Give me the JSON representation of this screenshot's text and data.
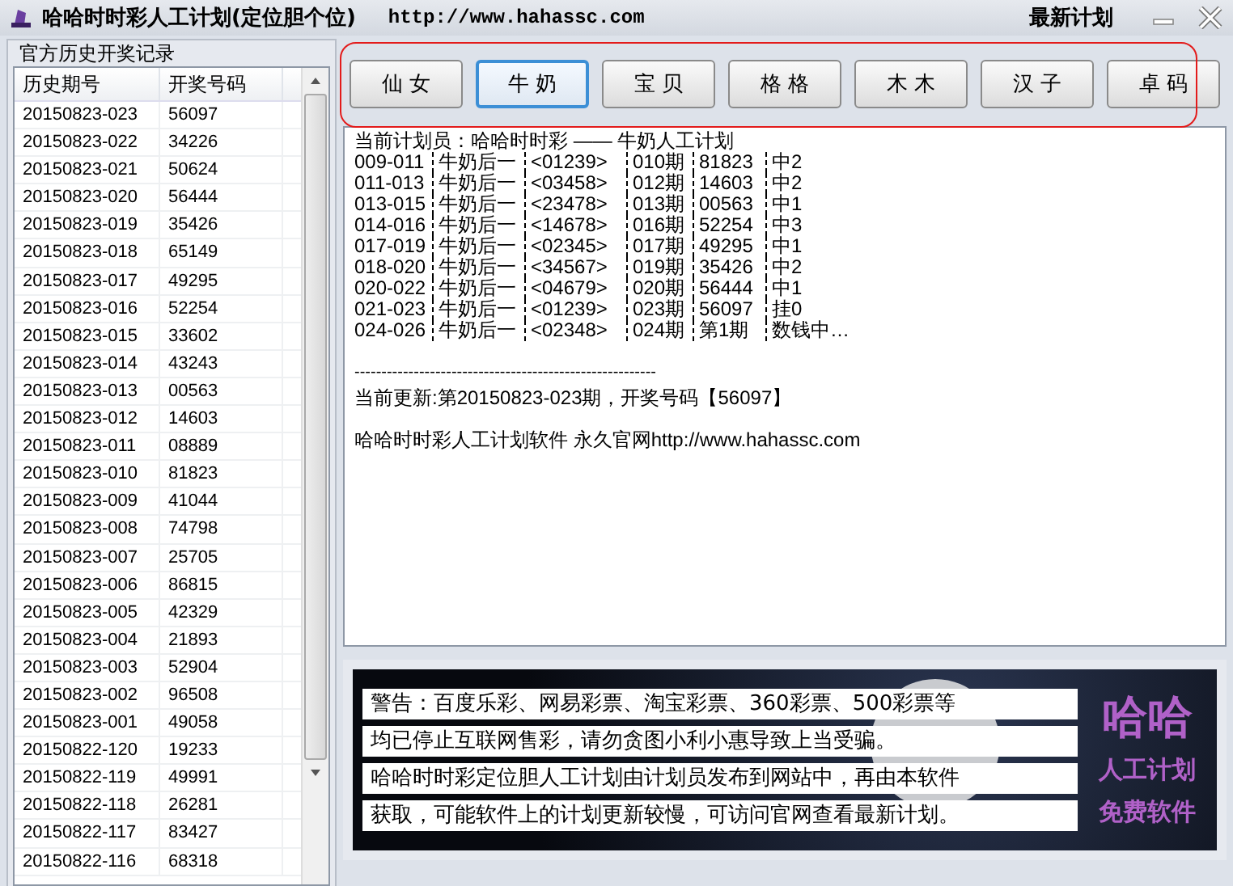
{
  "window": {
    "title": "哈哈时时彩人工计划(定位胆个位)",
    "url": "http://www.hahassc.com",
    "menu": "最新计划"
  },
  "history": {
    "title": "官方历史开奖记录",
    "columns": [
      "历史期号",
      "开奖号码"
    ],
    "rows": [
      [
        "20150823-023",
        "56097"
      ],
      [
        "20150823-022",
        "34226"
      ],
      [
        "20150823-021",
        "50624"
      ],
      [
        "20150823-020",
        "56444"
      ],
      [
        "20150823-019",
        "35426"
      ],
      [
        "20150823-018",
        "65149"
      ],
      [
        "20150823-017",
        "49295"
      ],
      [
        "20150823-016",
        "52254"
      ],
      [
        "20150823-015",
        "33602"
      ],
      [
        "20150823-014",
        "43243"
      ],
      [
        "20150823-013",
        "00563"
      ],
      [
        "20150823-012",
        "14603"
      ],
      [
        "20150823-011",
        "08889"
      ],
      [
        "20150823-010",
        "81823"
      ],
      [
        "20150823-009",
        "41044"
      ],
      [
        "20150823-008",
        "74798"
      ],
      [
        "20150823-007",
        "25705"
      ],
      [
        "20150823-006",
        "86815"
      ],
      [
        "20150823-005",
        "42329"
      ],
      [
        "20150823-004",
        "21893"
      ],
      [
        "20150823-003",
        "52904"
      ],
      [
        "20150823-002",
        "96508"
      ],
      [
        "20150823-001",
        "49058"
      ],
      [
        "20150822-120",
        "19233"
      ],
      [
        "20150822-119",
        "49991"
      ],
      [
        "20150822-118",
        "26281"
      ],
      [
        "20150822-117",
        "83427"
      ],
      [
        "20150822-116",
        "68318"
      ]
    ]
  },
  "planners": [
    {
      "label": "仙 女",
      "selected": false
    },
    {
      "label": "牛 奶",
      "selected": true
    },
    {
      "label": "宝 贝",
      "selected": false
    },
    {
      "label": "格 格",
      "selected": false
    },
    {
      "label": "木 木",
      "selected": false
    },
    {
      "label": "汉 子",
      "selected": false
    },
    {
      "label": "卓 码",
      "selected": false
    }
  ],
  "plan": {
    "heading": "当前计划员：哈哈时时彩 —— 牛奶人工计划",
    "lines": [
      [
        "009-011",
        "牛奶后一",
        "<01239>",
        "010期",
        "81823",
        "中2"
      ],
      [
        "011-013",
        "牛奶后一",
        "<03458>",
        "012期",
        "14603",
        "中2"
      ],
      [
        "013-015",
        "牛奶后一",
        "<23478>",
        "013期",
        "00563",
        "中1"
      ],
      [
        "014-016",
        "牛奶后一",
        "<14678>",
        "016期",
        "52254",
        "中3"
      ],
      [
        "017-019",
        "牛奶后一",
        "<02345>",
        "017期",
        "49295",
        "中1"
      ],
      [
        "018-020",
        "牛奶后一",
        "<34567>",
        "019期",
        "35426",
        "中2"
      ],
      [
        "020-022",
        "牛奶后一",
        "<04679>",
        "020期",
        "56444",
        "中1"
      ],
      [
        "021-023",
        "牛奶后一",
        "<01239>",
        "023期",
        "56097",
        "挂0"
      ],
      [
        "024-026",
        "牛奶后一",
        "<02348>",
        "024期",
        "第1期",
        "数钱中…"
      ]
    ],
    "separator": "--------------------------------------------------------",
    "update": "当前更新:第20150823-023期，开奖号码【56097】",
    "footer": "哈哈时时彩人工计划软件 永久官网",
    "footer_link": "http://www.hahassc.com"
  },
  "banner": {
    "lines": [
      "警告：百度乐彩、网易彩票、淘宝彩票、360彩票、500彩票等",
      "均已停止互联网售彩，请勿贪图小利小惠导致上当受骗。",
      "哈哈时时彩定位胆人工计划由计划员发布到网站中，再由本软件",
      "获取，可能软件上的计划更新较慢，可访问官网查看最新计划。"
    ],
    "side": [
      "哈哈",
      "人工计划",
      "免费软件"
    ]
  }
}
